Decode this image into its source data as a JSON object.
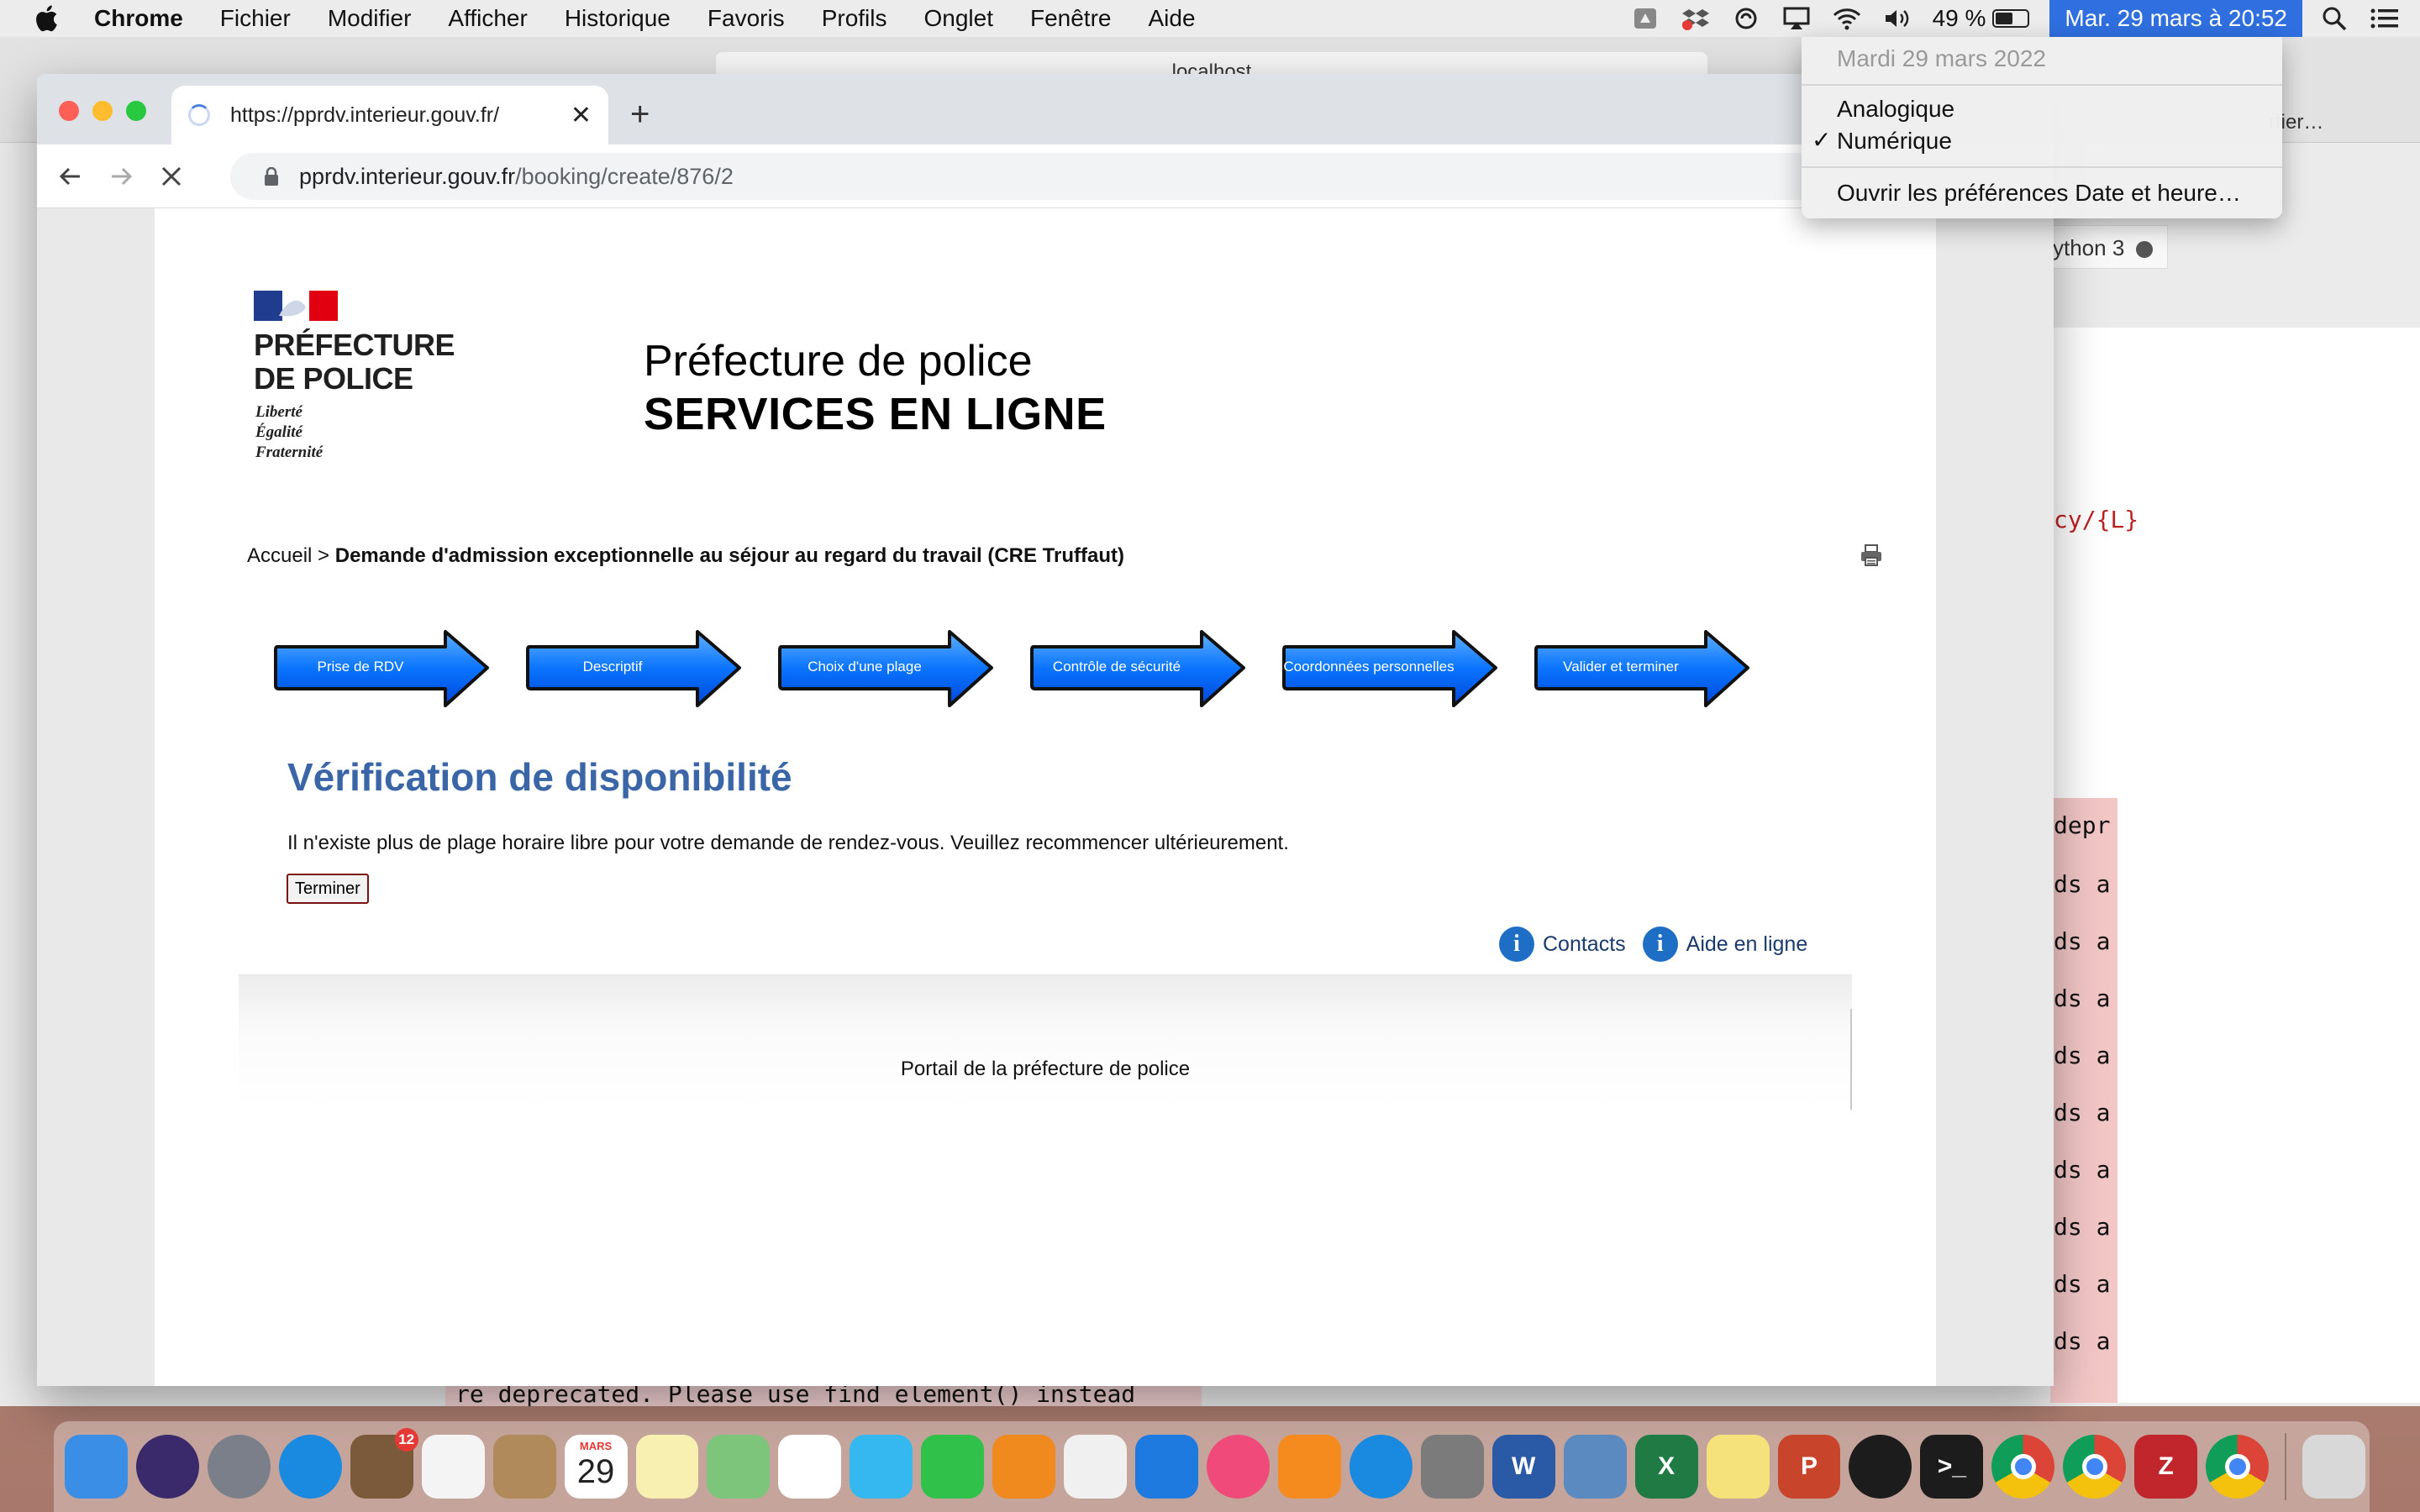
{
  "menubar": {
    "app": "Chrome",
    "menus": [
      "Fichier",
      "Modifier",
      "Afficher",
      "Historique",
      "Favoris",
      "Profils",
      "Onglet",
      "Fenêtre",
      "Aide"
    ],
    "battery": "49 %",
    "battery_level": 0.49,
    "clock": "Mar. 29 mars à  20:52"
  },
  "clock_menu": {
    "date": "Mardi 29 mars 2022",
    "options": [
      "Analogique",
      "Numérique"
    ],
    "selected": "Numérique",
    "preferences": "Ouvrir les préférences Date et heure…"
  },
  "background_app": {
    "url": "localhost",
    "tab": "rtier…",
    "kernel": "ython 3",
    "code_lines": [
      "cy/{L}",
      "depr",
      "ds a",
      "ds a",
      "ds a",
      "ds a",
      "ds a",
      "ds a",
      "ds a",
      "ds a",
      "ds a"
    ],
    "bottom_text": "re deprecated. Please use find element() instead"
  },
  "browser": {
    "tab_title": "https://pprdv.interieur.gouv.fr/",
    "tab_close": "✕",
    "new_tab": "+",
    "url_host": "pprdv.interieur.gouv.fr",
    "url_path": "/booking/create/876/2"
  },
  "site": {
    "logo": {
      "line1": "PRÉFECTURE",
      "line2": "DE POLICE",
      "motto": [
        "Liberté",
        "Égalité",
        "Fraternité"
      ]
    },
    "title": "Préfecture de police",
    "subtitle": "SERVICES EN LIGNE",
    "breadcrumb": {
      "home": "Accueil",
      "separator": ">",
      "current": "Demande d'admission exceptionnelle au séjour au regard du travail (CRE Truffaut)"
    },
    "steps": [
      "Prise de RDV",
      "Descriptif",
      "Choix d'une plage",
      "Contrôle de sécurité",
      "Coordonnées personnelles",
      "Valider et terminer"
    ],
    "heading": "Vérification de disponibilité",
    "message": "Il n'existe plus de plage horaire libre pour votre demande de rendez-vous. Veuillez recommencer ultérieurement.",
    "button": "Terminer",
    "links": {
      "contacts": "Contacts",
      "help": "Aide en ligne"
    },
    "footer": "Portail de la préfecture de police"
  },
  "dock": {
    "calendar_month": "MARS",
    "calendar_day": "29",
    "mail_badge": "12",
    "apps": [
      "finder",
      "siri",
      "launchpad",
      "safari",
      "mail",
      "reminders",
      "contacts",
      "calendar",
      "notes",
      "maps",
      "photos",
      "messages",
      "facetime",
      "pages",
      "numbers",
      "keynote",
      "itunes",
      "books",
      "app-store",
      "system-preferences",
      "word",
      "preview",
      "excel",
      "stickies",
      "powerpoint",
      "activity",
      "terminal",
      "chrome",
      "chrome",
      "zotero",
      "chrome",
      "trash"
    ]
  },
  "colors": {
    "heading": "#3a66a7",
    "link": "#1a3a6e",
    "step_blue": "#0a74ff",
    "menubar_highlight": "#2f6fe0"
  }
}
